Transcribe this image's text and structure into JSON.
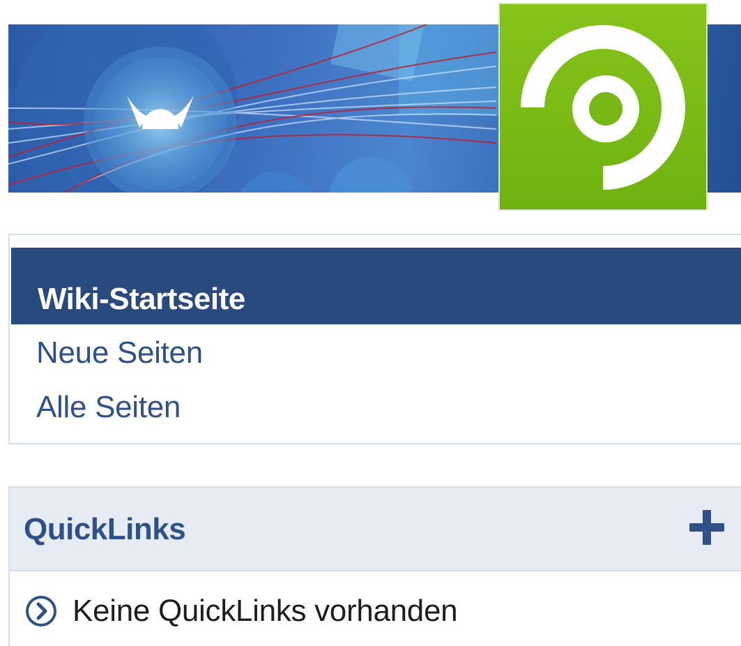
{
  "banner": {
    "icon": "viking-helmet-icon",
    "colors": {
      "background": "#2c5aa6",
      "accent_red": "#b3263a"
    }
  },
  "logo": {
    "icon": "green-spiral-logo-icon",
    "color": "#7cbc16"
  },
  "nav": {
    "active_item": "Wiki-Startseite",
    "links": [
      "Neue Seiten",
      "Alle Seiten"
    ],
    "colors": {
      "active_bg": "#284a7e",
      "link": "#2f5089"
    }
  },
  "quicklinks": {
    "title": "QuickLinks",
    "add_icon": "plus-icon",
    "empty_icon": "chevron-circle-right-icon",
    "empty_text": "Keine QuickLinks vorhanden",
    "colors": {
      "header_bg": "#e7ebf3"
    }
  }
}
